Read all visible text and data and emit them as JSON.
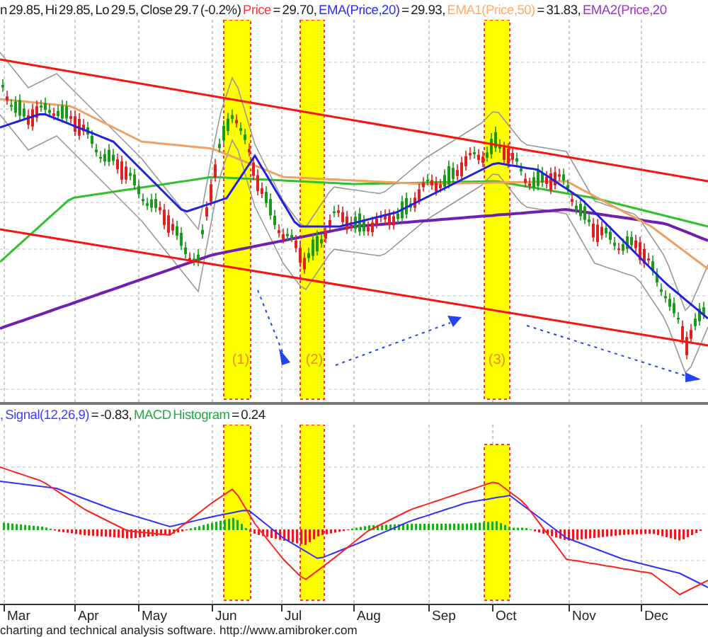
{
  "price_legend": [
    {
      "text": "n 29.85, Hi 29.85, Lo 29.5, Close 29.7 (-0.2%)",
      "color": "#202020"
    },
    {
      "text": "Price",
      "color": "#ff3030"
    },
    {
      "text": "= 29.70,",
      "color": "#202020"
    },
    {
      "text": "EMA(Price,20)",
      "color": "#2a2aff"
    },
    {
      "text": "= 29.93,",
      "color": "#202020"
    },
    {
      "text": "EMA1(Price,50)",
      "color": "#ffaa66"
    },
    {
      "text": "= 31.83,",
      "color": "#202020"
    },
    {
      "text": "EMA2(Price,20",
      "color": "#9933cc"
    }
  ],
  "markers": [
    {
      "label": "(1)"
    },
    {
      "label": "(2)"
    },
    {
      "label": "(3)"
    }
  ],
  "macd_legend": [
    {
      "text": ", Signal(12,26,9)",
      "color": "#4040ff"
    },
    {
      "text": "= -0.83,",
      "color": "#202020"
    },
    {
      "text": "MACD Histogram",
      "color": "#22aa44"
    },
    {
      "text": "= 0.24",
      "color": "#202020"
    }
  ],
  "months": [
    "Mar",
    "Apr",
    "May",
    "Jun",
    "Jul",
    "Aug",
    "Sep",
    "Oct",
    "Nov",
    "Dec"
  ],
  "footer": "charting and technical analysis software. http://www.amibroker.com"
}
